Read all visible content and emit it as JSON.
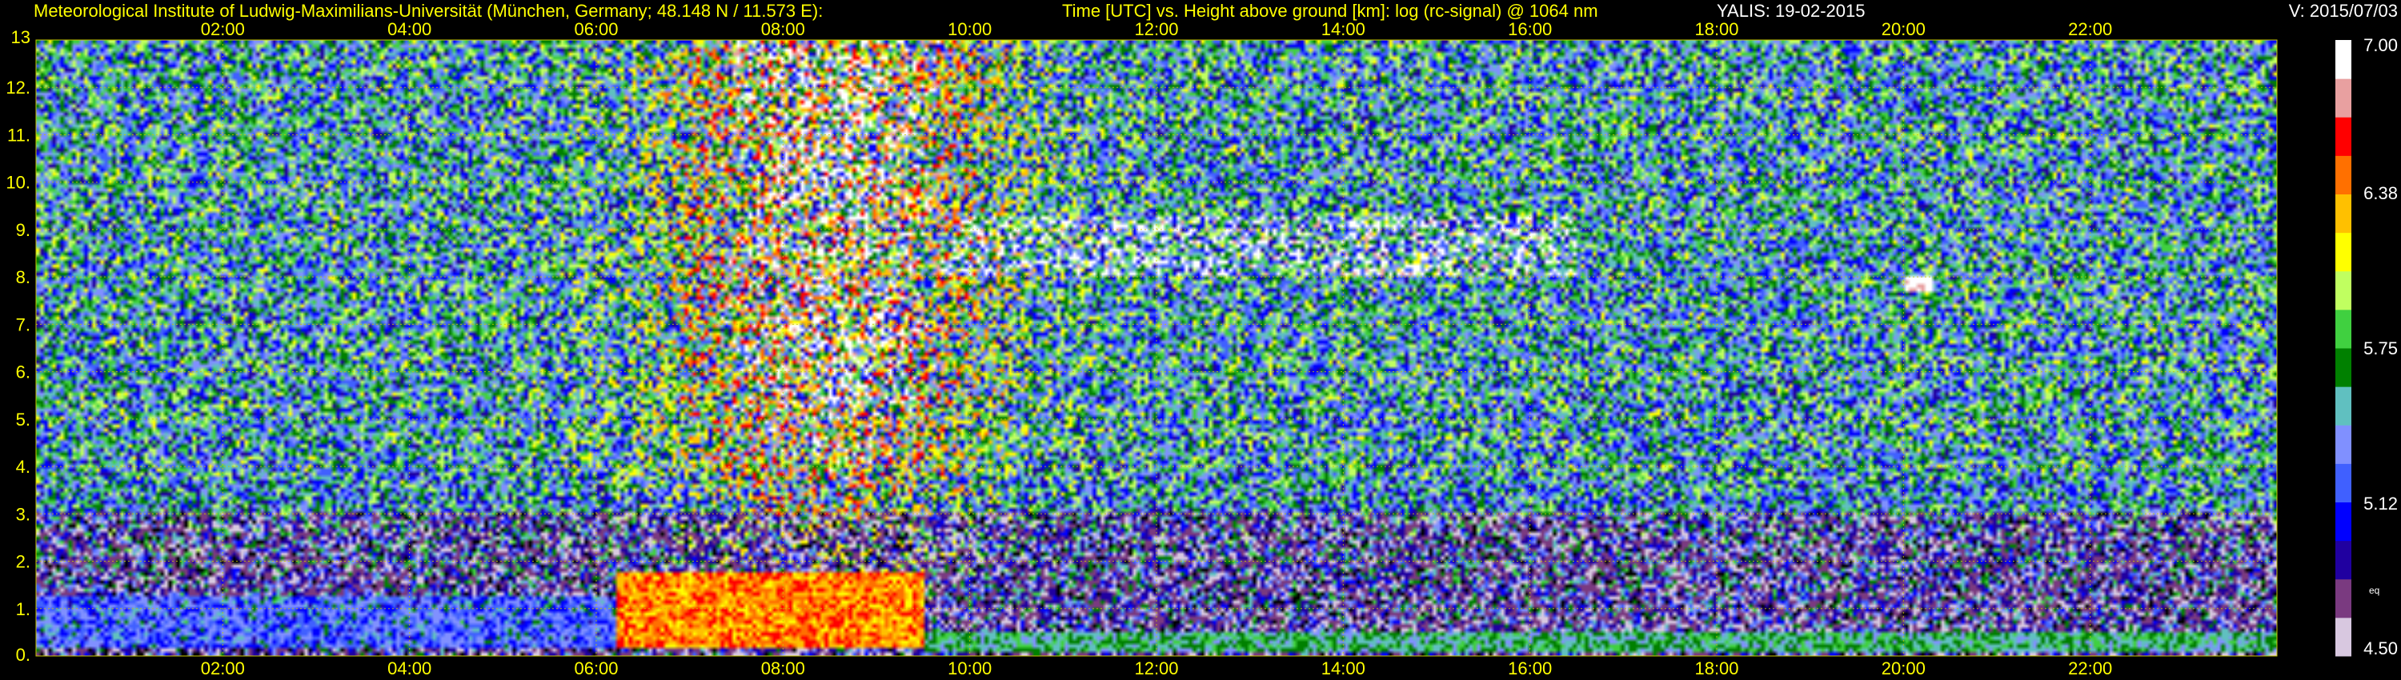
{
  "header": {
    "institute": "Meteorological Institute of Ludwig-Maximilians-Universität (München, Germany; 48.148 N / 11.573 E):",
    "axes_desc": "Time [UTC] vs. Height above ground [km]: log (rc-signal) @ 1064 nm",
    "instrument_date": "YALIS: 19-02-2015",
    "version": "V: 2015/07/03"
  },
  "colors": {
    "text": "#ffff00",
    "header_white": "#ffffff",
    "grid": "#c8c800",
    "background": "#000000"
  },
  "chart_data": {
    "type": "heatmap",
    "title": "Time [UTC] vs. Height above ground [km]: log (rc-signal) @ 1064 nm",
    "x_unit": "hour UTC",
    "xlim": [
      0,
      24
    ],
    "x_ticks": [
      2,
      4,
      6,
      8,
      10,
      12,
      14,
      16,
      18,
      20,
      22
    ],
    "x_tick_labels": [
      "02:00",
      "04:00",
      "06:00",
      "08:00",
      "10:00",
      "12:00",
      "14:00",
      "16:00",
      "18:00",
      "20:00",
      "22:00"
    ],
    "ylim": [
      0,
      13
    ],
    "y_ticks": [
      0,
      1,
      2,
      3,
      4,
      5,
      6,
      7,
      8,
      9,
      10,
      11,
      12,
      13
    ],
    "y_tick_labels": [
      "0.",
      "1.",
      "2.",
      "3.",
      "4.",
      "5.",
      "6.",
      "7.",
      "8.",
      "9.",
      "10.",
      "11.",
      "12.",
      "13"
    ],
    "grid": true,
    "colorbar": {
      "min": 4.5,
      "max": 7.0,
      "tick_values": [
        7.0,
        6.38,
        5.75,
        5.12,
        4.5
      ],
      "tick_labels": [
        "7.00",
        "6.38",
        "5.75",
        "5.12",
        "4.50"
      ],
      "unit_label": "eq",
      "colors": [
        "#d8c8e0",
        "#7a3a80",
        "#2000a0",
        "#0000ff",
        "#4060ff",
        "#8090ff",
        "#60c0c0",
        "#008000",
        "#40d040",
        "#c0ff60",
        "#ffff00",
        "#ffc000",
        "#ff7000",
        "#ff0000",
        "#e8a0a0",
        "#ffffff"
      ]
    },
    "features": [
      {
        "name": "nocturnal aerosol layer",
        "x": [
          0,
          6.2
        ],
        "y": [
          0.2,
          1.3
        ],
        "value": 5.2
      },
      {
        "name": "convective boundary layer peak",
        "x": [
          6.2,
          9.5
        ],
        "y": [
          0.2,
          1.8
        ],
        "value": 6.4
      },
      {
        "name": "surface layer",
        "x": [
          9.5,
          24
        ],
        "y": [
          0.05,
          0.5
        ],
        "value": 5.6
      },
      {
        "name": "cirrus clouds",
        "x": [
          9.7,
          16.5
        ],
        "y": [
          8.0,
          9.3
        ],
        "value": 7.0
      },
      {
        "name": "cloud patch",
        "x": [
          20.0,
          20.3
        ],
        "y": [
          7.7,
          8.0
        ],
        "value": 7.0
      }
    ]
  }
}
